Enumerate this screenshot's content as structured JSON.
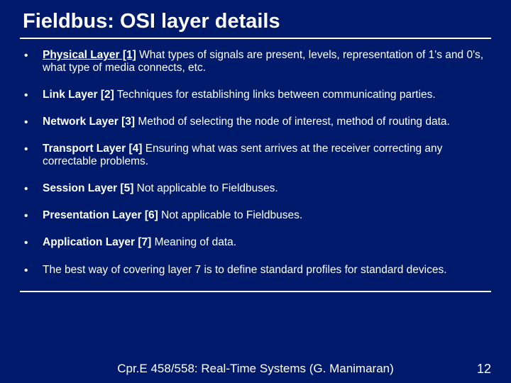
{
  "title": "Fieldbus: OSI layer details",
  "bullets": [
    {
      "heading": "Physical Layer [1]",
      "body": " What types of signals are present, levels, representation of 1's and 0's, what type of media connects, etc.",
      "underlineHeading": true
    },
    {
      "heading": "Link Layer [2]",
      "body": " Techniques for establishing links between communicating parties.",
      "underlineHeading": false
    },
    {
      "heading": "Network Layer [3]",
      "body": " Method of selecting the node of interest, method of routing data.",
      "underlineHeading": false
    },
    {
      "heading": "Transport Layer [4]",
      "body": " Ensuring what was sent arrives at the receiver correcting any correctable problems.",
      "underlineHeading": false
    },
    {
      "heading": "Session Layer [5]",
      "body": " Not applicable to Fieldbuses.",
      "underlineHeading": false
    },
    {
      "heading": "Presentation Layer [6]",
      "body": " Not applicable to Fieldbuses.",
      "underlineHeading": false
    },
    {
      "heading": "Application Layer [7]",
      "body": " Meaning of data.",
      "underlineHeading": false
    },
    {
      "heading": "",
      "body": "The best way of covering layer 7 is to define standard profiles for standard devices.",
      "underlineHeading": false
    }
  ],
  "footer": "Cpr.E 458/558: Real-Time Systems (G. Manimaran)",
  "page": "12",
  "dot": "•"
}
